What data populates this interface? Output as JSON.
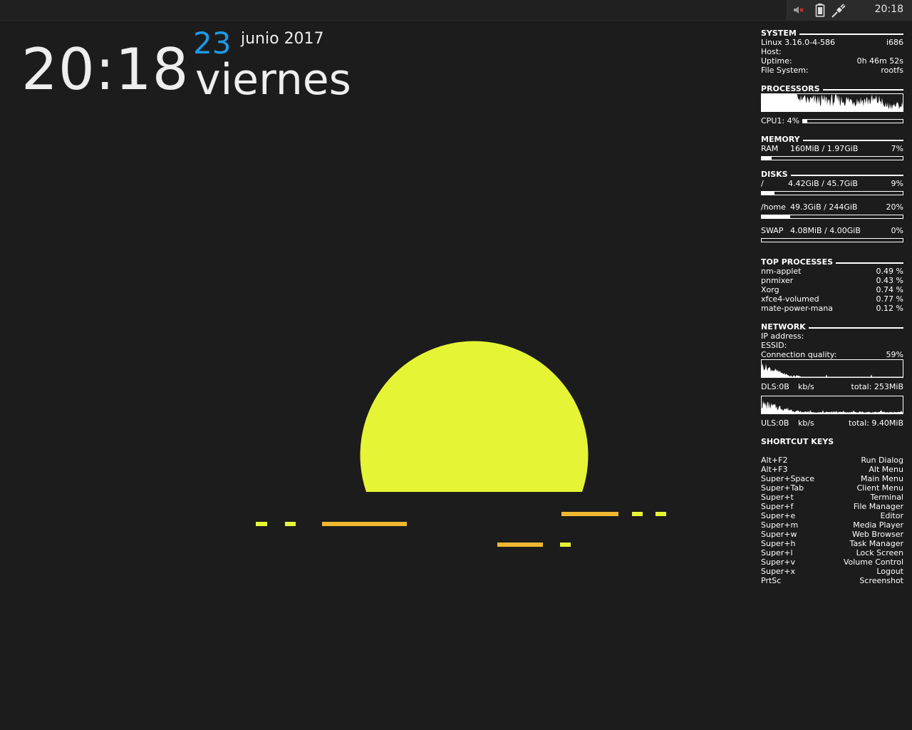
{
  "panel": {
    "clock": "20:18",
    "icons": [
      "volume-muted-icon",
      "battery-icon",
      "power-plug-icon"
    ]
  },
  "clock_widget": {
    "time": "20:18",
    "day": "23",
    "month_year": "junio 2017",
    "weekday": "viernes",
    "day_color": "#1c9ae8"
  },
  "wallpaper": {
    "sun_color": "#e5f536",
    "stripe_colors": [
      "#e5f536",
      "#f0b830"
    ]
  },
  "conky": {
    "system": {
      "title": "SYSTEM",
      "kernel": "Linux 3.16.0-4-586",
      "arch": "i686",
      "host_label": "Host:",
      "uptime_label": "Uptime:",
      "uptime": "0h 46m 52s",
      "fs_label": "File System:",
      "fs": "rootfs"
    },
    "processors": {
      "title": "PROCESSORS",
      "cpu_label": "CPU1: 4%",
      "cpu_fraction": 0.04
    },
    "memory": {
      "title": "MEMORY",
      "ram_label": "RAM",
      "ram_value": "160MiB / 1.97GiB",
      "ram_pct": "7%",
      "ram_fraction": 0.07
    },
    "disks": {
      "title": "DISKS",
      "items": [
        {
          "name": "/",
          "value": "4.42GiB / 45.7GiB",
          "pct": "9%",
          "fraction": 0.09
        },
        {
          "name": "/home",
          "value": "49.3GiB / 244GiB",
          "pct": "20%",
          "fraction": 0.2
        },
        {
          "name": "SWAP",
          "value": "4.08MiB / 4.00GiB",
          "pct": "0%",
          "fraction": 0.0
        }
      ]
    },
    "top_processes": {
      "title": "TOP PROCESSES",
      "items": [
        {
          "name": "nm-applet",
          "cpu": "0.49 %"
        },
        {
          "name": "pnmixer",
          "cpu": "0.43 %"
        },
        {
          "name": "Xorg",
          "cpu": "0.74 %"
        },
        {
          "name": "xfce4-volumed",
          "cpu": "0.77 %"
        },
        {
          "name": "mate-power-mana",
          "cpu": "0.12 %"
        }
      ]
    },
    "network": {
      "title": "NETWORK",
      "ip_label": "IP address:",
      "essid_label": "ESSID:",
      "quality_label": "Connection quality:",
      "quality": "59%",
      "dl_label": "DLS:0B",
      "dl_unit": "kb/s",
      "dl_total": "total: 253MiB",
      "ul_label": "ULS:0B",
      "ul_unit": "kb/s",
      "ul_total": "total: 9.40MiB"
    },
    "shortcuts": {
      "title": "SHORTCUT KEYS",
      "items": [
        {
          "key": "Alt+F2",
          "action": "Run Dialog"
        },
        {
          "key": "Alt+F3",
          "action": "Alt Menu"
        },
        {
          "key": "Super+Space",
          "action": "Main Menu"
        },
        {
          "key": "Super+Tab",
          "action": "Client Menu"
        },
        {
          "key": "Super+t",
          "action": "Terminal"
        },
        {
          "key": "Super+f",
          "action": "File Manager"
        },
        {
          "key": "Super+e",
          "action": "Editor"
        },
        {
          "key": "Super+m",
          "action": "Media Player"
        },
        {
          "key": "Super+w",
          "action": "Web Browser"
        },
        {
          "key": "Super+h",
          "action": "Task Manager"
        },
        {
          "key": "Super+l",
          "action": "Lock Screen"
        },
        {
          "key": "Super+v",
          "action": "Volume Control"
        },
        {
          "key": "Super+x",
          "action": "Logout"
        },
        {
          "key": "PrtSc",
          "action": "Screenshot"
        }
      ]
    }
  }
}
